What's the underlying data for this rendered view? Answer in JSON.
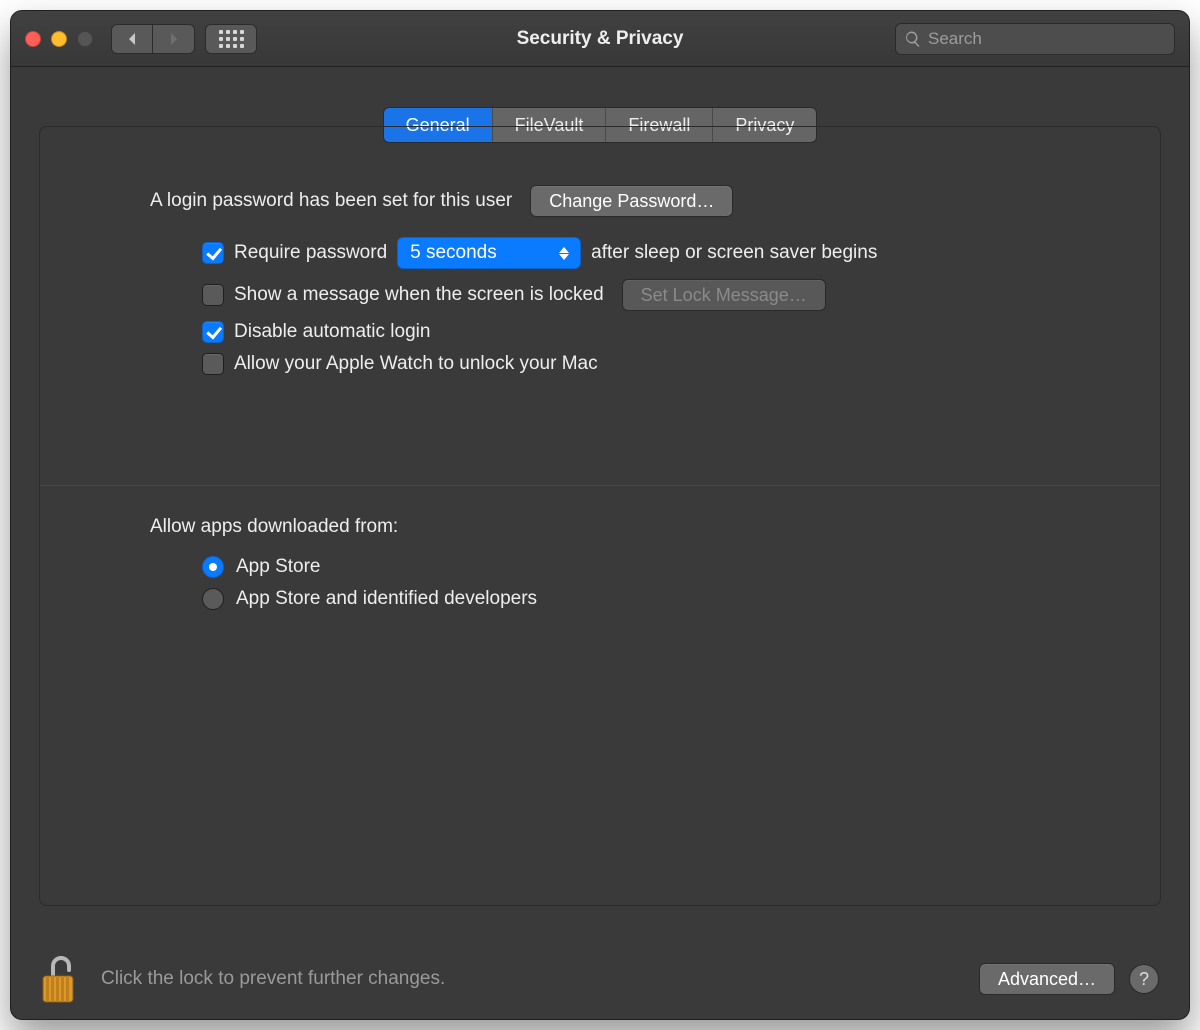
{
  "window": {
    "title": "Security & Privacy"
  },
  "search": {
    "placeholder": "Search"
  },
  "tabs": [
    "General",
    "FileVault",
    "Firewall",
    "Privacy"
  ],
  "active_tab": 0,
  "login": {
    "password_set_text": "A login password has been set for this user",
    "change_password_btn": "Change Password…",
    "require_password_label_pre": "Require password",
    "require_password_delay": "5 seconds",
    "require_password_label_post": "after sleep or screen saver begins",
    "require_password_checked": true,
    "show_message_label": "Show a message when the screen is locked",
    "show_message_checked": false,
    "set_lock_message_btn": "Set Lock Message…",
    "disable_auto_login_label": "Disable automatic login",
    "disable_auto_login_checked": true,
    "apple_watch_label": "Allow your Apple Watch to unlock your Mac",
    "apple_watch_checked": false
  },
  "gatekeeper": {
    "title": "Allow apps downloaded from:",
    "options": [
      "App Store",
      "App Store and identified developers"
    ],
    "selected": 0
  },
  "footer": {
    "lock_hint": "Click the lock to prevent further changes.",
    "advanced_btn": "Advanced…",
    "help": "?"
  }
}
